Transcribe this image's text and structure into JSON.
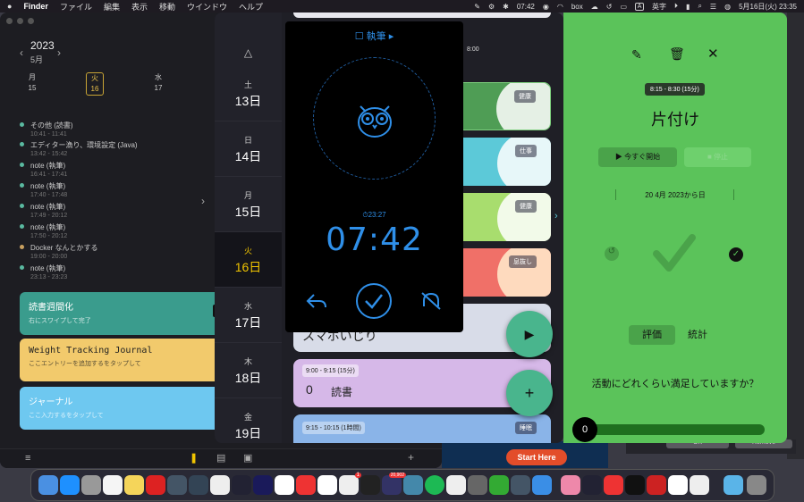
{
  "menubar": {
    "apple": "",
    "items": [
      "Finder",
      "ファイル",
      "編集",
      "表示",
      "移動",
      "ウインドウ",
      "ヘルプ"
    ],
    "time_widget": "07:42",
    "box": "box",
    "input": "A",
    "input_label": "英字",
    "battery": "",
    "datetime": "5月16日(火) 23:35"
  },
  "left": {
    "year": "2023",
    "month": "5月",
    "prev": "‹",
    "next": "›",
    "days": [
      {
        "w": "月",
        "n": "15"
      },
      {
        "w": "火",
        "n": "16"
      },
      {
        "w": "水",
        "n": "17"
      }
    ],
    "events": [
      {
        "name": "その他 (読書)",
        "time": "10:41 - 11:41",
        "color": "#5ab9a0"
      },
      {
        "name": "エディター漁り、環境設定 (Java)",
        "time": "13:42 - 15:42",
        "color": "#5ab9a0"
      },
      {
        "name": "note (執筆)",
        "time": "16:41 - 17:41",
        "color": "#5ab9a0"
      },
      {
        "name": "note (執筆)",
        "time": "17:40 - 17:48",
        "color": "#5ab9a0"
      },
      {
        "name": "note (執筆)",
        "time": "17:49 - 20:12",
        "color": "#5ab9a0"
      },
      {
        "name": "note (執筆)",
        "time": "17:50 - 20:12",
        "color": "#5ab9a0"
      },
      {
        "name": "Docker なんとかする",
        "time": "19:00 - 20:00",
        "color": "#c8a060"
      },
      {
        "name": "note (執筆)",
        "time": "23:13 - 23:23",
        "color": "#5ab9a0"
      }
    ],
    "arrow": "›",
    "cards": [
      {
        "title": "読書週間化",
        "sub": "右にスワイプして完了",
        "bg": "#3a9c8d"
      },
      {
        "title": "Weight Tracking Journal",
        "sub": "ここエントリーを追加するをタップして",
        "bg": "#f2ca6c"
      },
      {
        "title": "ジャーナル",
        "sub": "ここ入力するをタップして",
        "bg": "#6ec8f0"
      }
    ],
    "toolbar_plus": "+"
  },
  "daylist": {
    "up": "△",
    "days": [
      {
        "w": "土",
        "d": "13日"
      },
      {
        "w": "日",
        "d": "14日"
      },
      {
        "w": "月",
        "d": "15日"
      },
      {
        "w": "火",
        "d": "16日"
      },
      {
        "w": "水",
        "d": "17日"
      },
      {
        "w": "木",
        "d": "18日"
      },
      {
        "w": "金",
        "d": "19日"
      }
    ],
    "time_header": "8:00",
    "tasks": [
      {
        "tag": "健康",
        "bg": "#4f9d55",
        "text": "",
        "time": ""
      },
      {
        "tag": "仕事",
        "bg": "#5cc9d8",
        "text": "",
        "time": ""
      },
      {
        "tag": "健康",
        "bg": "#a8dd6e",
        "text": "",
        "time": ""
      },
      {
        "tag": "息抜し",
        "bg": "#f07068",
        "text": "",
        "time": ""
      },
      {
        "tag": "",
        "bg": "#d8dce8",
        "text": "スマホいじり",
        "time": ""
      },
      {
        "tag": "",
        "bg": "#d6b8e8",
        "text": "読書",
        "time": "9:00 - 9:15 (15分)",
        "count": "0"
      },
      {
        "tag": "睡眠",
        "bg": "#8ab4e8",
        "text": "",
        "time": "9:15 - 10:15 (1時間)"
      }
    ],
    "play": "▶",
    "add": "+"
  },
  "timer": {
    "title": "執筆",
    "sub": "⏱23:27",
    "clock": "07:42"
  },
  "detail": {
    "time_badge": "8:15 - 8:30 (15分)",
    "title": "片付け",
    "start_label": "▶ 今すぐ開始",
    "stop_label": "■ 停止",
    "since": "20 4月 2023から日",
    "tab_rate": "評価",
    "tab_stats": "統計",
    "question": "活動にどれくらい満足していますか？",
    "score": "0",
    "score_fraction": 0
  },
  "background": {
    "start_here": "Start Here",
    "btn1": "OK",
    "btn2": "Remove"
  },
  "dock": {
    "badge1": "1",
    "badge2": "20,902"
  }
}
